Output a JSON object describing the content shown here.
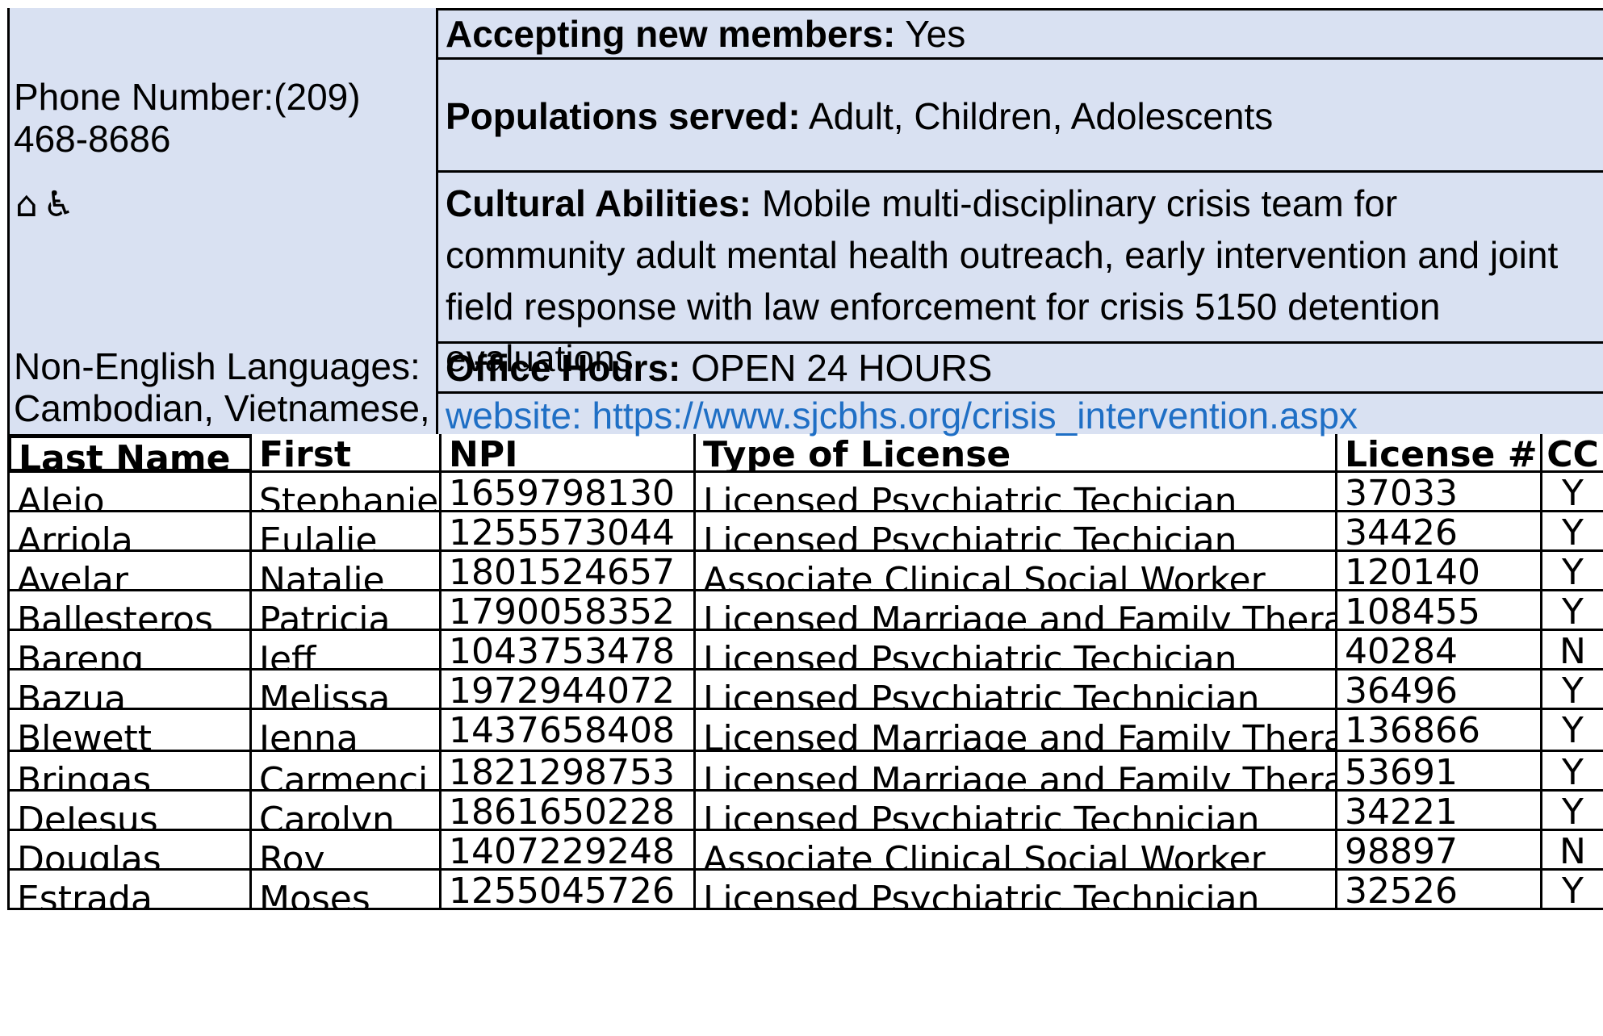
{
  "info": {
    "phone": "Phone Number:(209) 468-8686",
    "icons": [
      "home-icon",
      "wheelchair-icon"
    ],
    "icon_glyphs": "⌂♿",
    "languages_label": "Non-English Languages:",
    "languages_value": "Cambodian, Vietnamese, S",
    "accepting_label": "Accepting new members:",
    "accepting_value": "Yes",
    "populations_label": "Populations served:",
    "populations_value": "Adult, Children, Adolescents",
    "cultural_label": "Cultural Abilities:",
    "cultural_value": "Mobile multi-disciplinary crisis team for community adult mental health outreach, early intervention and joint field response with law enforcement for crisis 5150 detention evaluations.",
    "hours_label": "Office Hours:",
    "hours_value": "OPEN 24 HOURS",
    "website": "website: https://www.sjcbhs.org/crisis_intervention.aspx",
    "colors": {
      "panel_bg": "#d9e1f2",
      "link": "#1f6fc5"
    }
  },
  "table": {
    "headers": [
      "Last Name",
      "First",
      "NPI",
      "Type of License",
      "License #",
      "CC"
    ],
    "rows": [
      [
        "Alejo",
        "Stephanie",
        "1659798130",
        "Licensed Psychiatric Techician",
        "37033",
        "Y"
      ],
      [
        "Arriola",
        "Eulalie",
        "1255573044",
        "Licensed Psychiatric Techician",
        "34426",
        "Y"
      ],
      [
        "Avelar",
        "Natalie",
        "1801524657",
        "Associate Clinical Social Worker",
        "120140",
        "Y"
      ],
      [
        "Ballesteros",
        "Patricia",
        "1790058352",
        "Licensed Marriage and Family Thera",
        "108455",
        "Y"
      ],
      [
        "Bareng",
        "Jeff",
        "1043753478",
        "Licensed Psychiatric Techician",
        "40284",
        "N"
      ],
      [
        "Bazua",
        "Melissa",
        "1972944072",
        "Licensed Psychiatric Technician",
        "36496",
        "Y"
      ],
      [
        "Blewett",
        "Jenna",
        "1437658408",
        "Licensed Marriage and Family Thera",
        "136866",
        "Y"
      ],
      [
        "Bringas",
        "Carmenci",
        "1821298753",
        "Licensed Marriage and Family Thera",
        "53691",
        "Y"
      ],
      [
        "DeJesus",
        "Carolyn",
        "1861650228",
        "Licensed Psychiatric Technician",
        "34221",
        "Y"
      ],
      [
        "Douglas",
        "Roy",
        "1407229248",
        "Associate Clinical Social Worker",
        "98897",
        "N"
      ],
      [
        "Estrada",
        "Moses",
        "1255045726",
        "Licensed Psychiatric Technician",
        "32526",
        "Y"
      ]
    ]
  }
}
